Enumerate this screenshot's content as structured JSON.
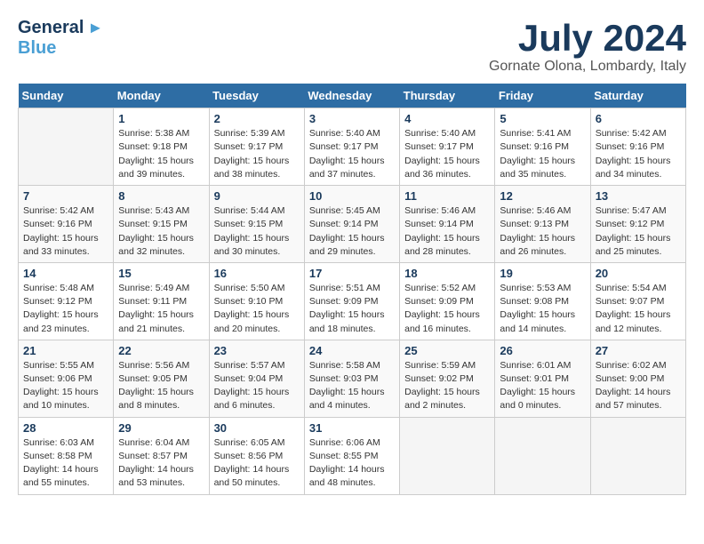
{
  "header": {
    "logo_general": "General",
    "logo_blue": "Blue",
    "month_title": "July 2024",
    "location": "Gornate Olona, Lombardy, Italy"
  },
  "weekdays": [
    "Sunday",
    "Monday",
    "Tuesday",
    "Wednesday",
    "Thursday",
    "Friday",
    "Saturday"
  ],
  "weeks": [
    [
      {
        "day": "",
        "info": ""
      },
      {
        "day": "1",
        "info": "Sunrise: 5:38 AM\nSunset: 9:18 PM\nDaylight: 15 hours\nand 39 minutes."
      },
      {
        "day": "2",
        "info": "Sunrise: 5:39 AM\nSunset: 9:17 PM\nDaylight: 15 hours\nand 38 minutes."
      },
      {
        "day": "3",
        "info": "Sunrise: 5:40 AM\nSunset: 9:17 PM\nDaylight: 15 hours\nand 37 minutes."
      },
      {
        "day": "4",
        "info": "Sunrise: 5:40 AM\nSunset: 9:17 PM\nDaylight: 15 hours\nand 36 minutes."
      },
      {
        "day": "5",
        "info": "Sunrise: 5:41 AM\nSunset: 9:16 PM\nDaylight: 15 hours\nand 35 minutes."
      },
      {
        "day": "6",
        "info": "Sunrise: 5:42 AM\nSunset: 9:16 PM\nDaylight: 15 hours\nand 34 minutes."
      }
    ],
    [
      {
        "day": "7",
        "info": "Sunrise: 5:42 AM\nSunset: 9:16 PM\nDaylight: 15 hours\nand 33 minutes."
      },
      {
        "day": "8",
        "info": "Sunrise: 5:43 AM\nSunset: 9:15 PM\nDaylight: 15 hours\nand 32 minutes."
      },
      {
        "day": "9",
        "info": "Sunrise: 5:44 AM\nSunset: 9:15 PM\nDaylight: 15 hours\nand 30 minutes."
      },
      {
        "day": "10",
        "info": "Sunrise: 5:45 AM\nSunset: 9:14 PM\nDaylight: 15 hours\nand 29 minutes."
      },
      {
        "day": "11",
        "info": "Sunrise: 5:46 AM\nSunset: 9:14 PM\nDaylight: 15 hours\nand 28 minutes."
      },
      {
        "day": "12",
        "info": "Sunrise: 5:46 AM\nSunset: 9:13 PM\nDaylight: 15 hours\nand 26 minutes."
      },
      {
        "day": "13",
        "info": "Sunrise: 5:47 AM\nSunset: 9:12 PM\nDaylight: 15 hours\nand 25 minutes."
      }
    ],
    [
      {
        "day": "14",
        "info": "Sunrise: 5:48 AM\nSunset: 9:12 PM\nDaylight: 15 hours\nand 23 minutes."
      },
      {
        "day": "15",
        "info": "Sunrise: 5:49 AM\nSunset: 9:11 PM\nDaylight: 15 hours\nand 21 minutes."
      },
      {
        "day": "16",
        "info": "Sunrise: 5:50 AM\nSunset: 9:10 PM\nDaylight: 15 hours\nand 20 minutes."
      },
      {
        "day": "17",
        "info": "Sunrise: 5:51 AM\nSunset: 9:09 PM\nDaylight: 15 hours\nand 18 minutes."
      },
      {
        "day": "18",
        "info": "Sunrise: 5:52 AM\nSunset: 9:09 PM\nDaylight: 15 hours\nand 16 minutes."
      },
      {
        "day": "19",
        "info": "Sunrise: 5:53 AM\nSunset: 9:08 PM\nDaylight: 15 hours\nand 14 minutes."
      },
      {
        "day": "20",
        "info": "Sunrise: 5:54 AM\nSunset: 9:07 PM\nDaylight: 15 hours\nand 12 minutes."
      }
    ],
    [
      {
        "day": "21",
        "info": "Sunrise: 5:55 AM\nSunset: 9:06 PM\nDaylight: 15 hours\nand 10 minutes."
      },
      {
        "day": "22",
        "info": "Sunrise: 5:56 AM\nSunset: 9:05 PM\nDaylight: 15 hours\nand 8 minutes."
      },
      {
        "day": "23",
        "info": "Sunrise: 5:57 AM\nSunset: 9:04 PM\nDaylight: 15 hours\nand 6 minutes."
      },
      {
        "day": "24",
        "info": "Sunrise: 5:58 AM\nSunset: 9:03 PM\nDaylight: 15 hours\nand 4 minutes."
      },
      {
        "day": "25",
        "info": "Sunrise: 5:59 AM\nSunset: 9:02 PM\nDaylight: 15 hours\nand 2 minutes."
      },
      {
        "day": "26",
        "info": "Sunrise: 6:01 AM\nSunset: 9:01 PM\nDaylight: 15 hours\nand 0 minutes."
      },
      {
        "day": "27",
        "info": "Sunrise: 6:02 AM\nSunset: 9:00 PM\nDaylight: 14 hours\nand 57 minutes."
      }
    ],
    [
      {
        "day": "28",
        "info": "Sunrise: 6:03 AM\nSunset: 8:58 PM\nDaylight: 14 hours\nand 55 minutes."
      },
      {
        "day": "29",
        "info": "Sunrise: 6:04 AM\nSunset: 8:57 PM\nDaylight: 14 hours\nand 53 minutes."
      },
      {
        "day": "30",
        "info": "Sunrise: 6:05 AM\nSunset: 8:56 PM\nDaylight: 14 hours\nand 50 minutes."
      },
      {
        "day": "31",
        "info": "Sunrise: 6:06 AM\nSunset: 8:55 PM\nDaylight: 14 hours\nand 48 minutes."
      },
      {
        "day": "",
        "info": ""
      },
      {
        "day": "",
        "info": ""
      },
      {
        "day": "",
        "info": ""
      }
    ]
  ]
}
